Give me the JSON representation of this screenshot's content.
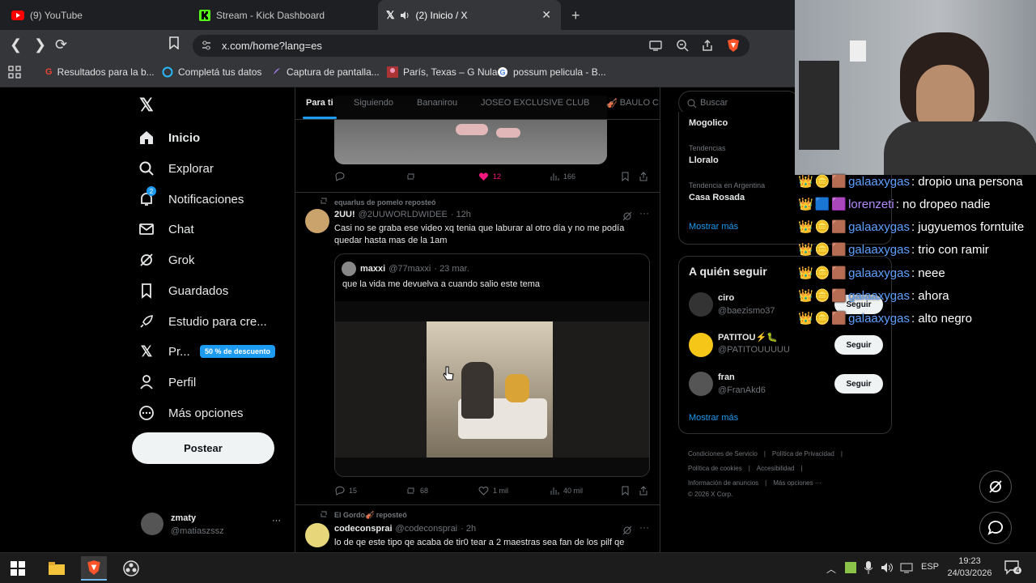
{
  "browser": {
    "tabs": [
      {
        "label": "(9) YouTube",
        "icon": "youtube-icon"
      },
      {
        "label": "Stream - Kick Dashboard",
        "icon": "kick-icon"
      },
      {
        "label": "(2) Inicio / X",
        "icon": "x-logo-icon"
      }
    ],
    "close_glyph": "✕",
    "new_tab_glyph": "+",
    "url": "x.com/home?lang=es",
    "bookmarks": [
      {
        "label": "Resultados para la b..."
      },
      {
        "label": "Completá tus datos"
      },
      {
        "label": "Captura de pantalla..."
      },
      {
        "label": "París, Texas – G Nula"
      },
      {
        "label": "possum pelicula - B..."
      }
    ]
  },
  "sidebar": {
    "items": [
      {
        "label": "Inicio",
        "icon": "home-icon"
      },
      {
        "label": "Explorar",
        "icon": "search-icon"
      },
      {
        "label": "Notificaciones",
        "icon": "bell-icon",
        "badge": "2"
      },
      {
        "label": "Chat",
        "icon": "mail-icon"
      },
      {
        "label": "Grok",
        "icon": "grok-icon"
      },
      {
        "label": "Guardados",
        "icon": "bookmark-icon"
      },
      {
        "label": "Estudio para cre...",
        "icon": "rocket-icon"
      },
      {
        "label": "Pr...",
        "icon": "x-logo-icon"
      },
      {
        "label": "Perfil",
        "icon": "person-icon"
      },
      {
        "label": "Más opciones",
        "icon": "more-circle-icon"
      }
    ],
    "promo": "50 % de descuento",
    "post_button": "Postear",
    "account": {
      "name": "zmaty",
      "handle": "@matiaszssz",
      "more": "···"
    }
  },
  "feed": {
    "tabs": [
      "Para ti",
      "Siguiendo",
      "Bananirou",
      "JOSEO EXCLUSIVE CLUB",
      "BAULO CL"
    ],
    "post0_actions": {
      "replies": "",
      "reposts": "",
      "likes": "12",
      "views": "166"
    },
    "post1": {
      "reposted_by": "equarlus de pomelo reposteó",
      "name": "2UU!",
      "handle": "@2UUWORLDWIDEE",
      "time": "· 12h",
      "text": "Casi no se graba ese video xq tenia que laburar al otro día y no me podía quedar hasta mas de la 1am",
      "quote": {
        "name": "maxxi",
        "handle": "@77maxxi",
        "time": "· 23 mar.",
        "text": "que la vida me devuelva a cuando salio este tema"
      },
      "actions": {
        "replies": "15",
        "reposts": "68",
        "likes": "1 mil",
        "views": "40 mil"
      }
    },
    "post2": {
      "reposted_by": "El Gordo🎻 reposteó",
      "name": "codeconsprai",
      "handle": "@codeconsprai",
      "time": "· 2h",
      "text": "lo de qe este tipo qe acaba de tir0 tear a 2 maestras sea fan de los pilf qe"
    }
  },
  "right": {
    "search_placeholder": "Buscar",
    "trends": [
      {
        "context": "",
        "title": "Mogolico"
      },
      {
        "context": "Tendencias",
        "title": "Lloralo"
      },
      {
        "context": "Tendencia en Argentina",
        "title": "Casa Rosada"
      }
    ],
    "show_more": "Mostrar más",
    "who_to_follow": {
      "title": "A quién seguir",
      "users": [
        {
          "name": "ciro",
          "handle": "@baezismo37",
          "button": "Seguir"
        },
        {
          "name": "PATITOU⚡🐛",
          "handle": "@PATITOUUUUU",
          "button": "Seguir"
        },
        {
          "name": "fran",
          "handle": "@FranAkd6",
          "button": "Seguir"
        }
      ],
      "show_more": "Mostrar más"
    },
    "footer": [
      "Condiciones de Servicio",
      "Política de Privacidad",
      "Política de cookies",
      "Accesibilidad",
      "Información de anuncios",
      "Más opciones ···",
      "© 2026 X Corp."
    ]
  },
  "chat": {
    "messages": [
      {
        "user": "galaaxygas",
        "text": ": dropio una persona"
      },
      {
        "user": "lorenzeti",
        "text": ": no dropeo nadie"
      },
      {
        "user": "galaaxygas",
        "text": ": jugyuemos forntuite"
      },
      {
        "user": "galaaxygas",
        "text": ": trio con ramir"
      },
      {
        "user": "galaaxygas",
        "text": ": neee"
      },
      {
        "user": "galaaxygas",
        "text": ": ahora"
      },
      {
        "user": "galaaxygas",
        "text": ": alto negro"
      }
    ]
  },
  "taskbar": {
    "language": "ESP",
    "time": "19:23",
    "date": "24/03/2026",
    "notifications": "4"
  }
}
